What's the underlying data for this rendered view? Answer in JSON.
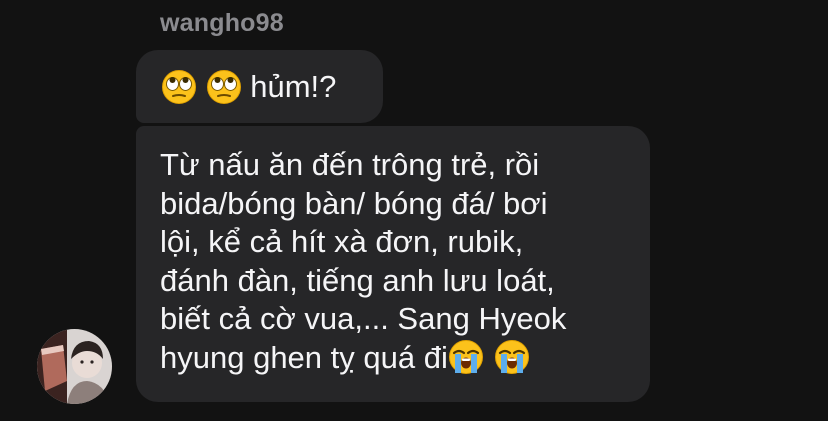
{
  "sender": {
    "username": "wangho98"
  },
  "messages": [
    {
      "emojis": [
        "face-with-rolling-eyes",
        "face-with-rolling-eyes"
      ],
      "text": "hủm!?"
    },
    {
      "lines": [
        "Từ nấu ăn đến trông trẻ, rồi",
        "bida/bóng bàn/ bóng đá/ bơi",
        "lội, kể cả hít xà đơn, rubik,",
        "đánh đàn, tiếng anh lưu loát,",
        "biết cả cờ vua,... Sang Hyeok",
        "hyung ghen tỵ quá đi"
      ],
      "trailing_emojis": [
        "loudly-crying-face",
        "loudly-crying-face"
      ]
    }
  ],
  "colors": {
    "background": "#121212",
    "bubble": "#262628",
    "text": "#f5f5f7",
    "username": "#8b8b8f"
  }
}
